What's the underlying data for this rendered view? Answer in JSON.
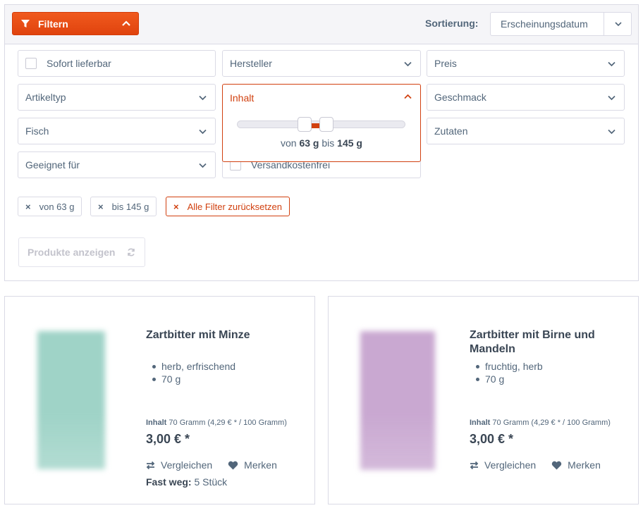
{
  "header": {
    "filter_label": "Filtern",
    "sort_label": "Sortierung:",
    "sort_value": "Erscheinungsdatum"
  },
  "filters": {
    "sofort": "Sofort lieferbar",
    "hersteller": "Hersteller",
    "preis": "Preis",
    "artikeltyp": "Artikeltyp",
    "inhalt": "Inhalt",
    "geschmack": "Geschmack",
    "fisch": "Fisch",
    "zutaten": "Zutaten",
    "geeignet": "Geeignet für",
    "versand": "Versandkostenfrei"
  },
  "range": {
    "from_word": "von",
    "from_value": "63 g",
    "to_word": "bis",
    "to_value": "145 g",
    "slider_low": 0.4,
    "slider_high": 0.53
  },
  "chips": {
    "from": "von 63 g",
    "to": "bis 145 g",
    "reset": "Alle Filter zurücksetzen"
  },
  "show_button": "Produkte anzeigen",
  "products": [
    {
      "name": "Zartbitter mit Minze",
      "features": [
        "herb, erfrischend",
        "70 g"
      ],
      "unit_label": "Inhalt",
      "unit_text": "70 Gramm (4,29 € * / 100 Gramm)",
      "price": "3,00 € *",
      "compare": "Vergleichen",
      "wishlist": "Merken",
      "stock_label": "Fast weg:",
      "stock_value": "5 Stück",
      "color": "#9fd3c7"
    },
    {
      "name": "Zartbitter mit Birne und Mandeln",
      "features": [
        "fruchtig, herb",
        "70 g"
      ],
      "unit_label": "Inhalt",
      "unit_text": "70 Gramm (4,29 € * / 100 Gramm)",
      "price": "3,00 € *",
      "compare": "Vergleichen",
      "wishlist": "Merken",
      "color": "#c9a8d1"
    }
  ],
  "colors": {
    "accent": "#e0430e",
    "accent_dark": "#d1400f",
    "text": "#52667a",
    "border": "#dadae5"
  }
}
